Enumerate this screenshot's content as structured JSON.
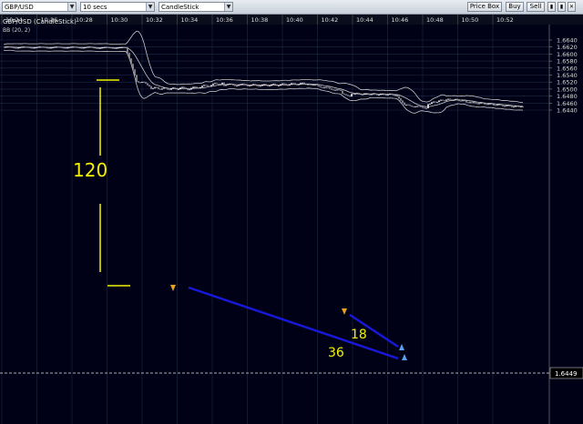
{
  "toolbar": {
    "symbol": "GBP/USD",
    "interval": "10 secs",
    "chart_style": "CandleStick",
    "price_box_label": "Price Box",
    "buy_label": "Buy",
    "sell_label": "Sell"
  },
  "chart": {
    "title": "GBP/USD (CandleStick)",
    "indicator": "BB (20, 2)",
    "time_labels": [
      "10:24",
      "10:26",
      "10:28",
      "10:30",
      "10:32",
      "10:34",
      "10:36",
      "10:38",
      "10:40",
      "10:42",
      "10:44",
      "10:46",
      "10:48",
      "10:50",
      "10:52"
    ],
    "price_labels": [
      "1.6640",
      "1.6620",
      "1.6600",
      "1.6580",
      "1.6560",
      "1.6540",
      "1.6520",
      "1.6500",
      "1.6480",
      "1.6460",
      "1.6440"
    ],
    "current_price": "1.6449",
    "annotations": {
      "drop": "120",
      "move_a": "18",
      "move_b": "36"
    },
    "colors": {
      "background": "#000016",
      "grid": "#1e2c48",
      "bands": "#c8c8c8",
      "candles": "#d0d0d0",
      "annotation_yellow": "#f2f200",
      "trendline_blue": "#1818d8"
    }
  }
}
